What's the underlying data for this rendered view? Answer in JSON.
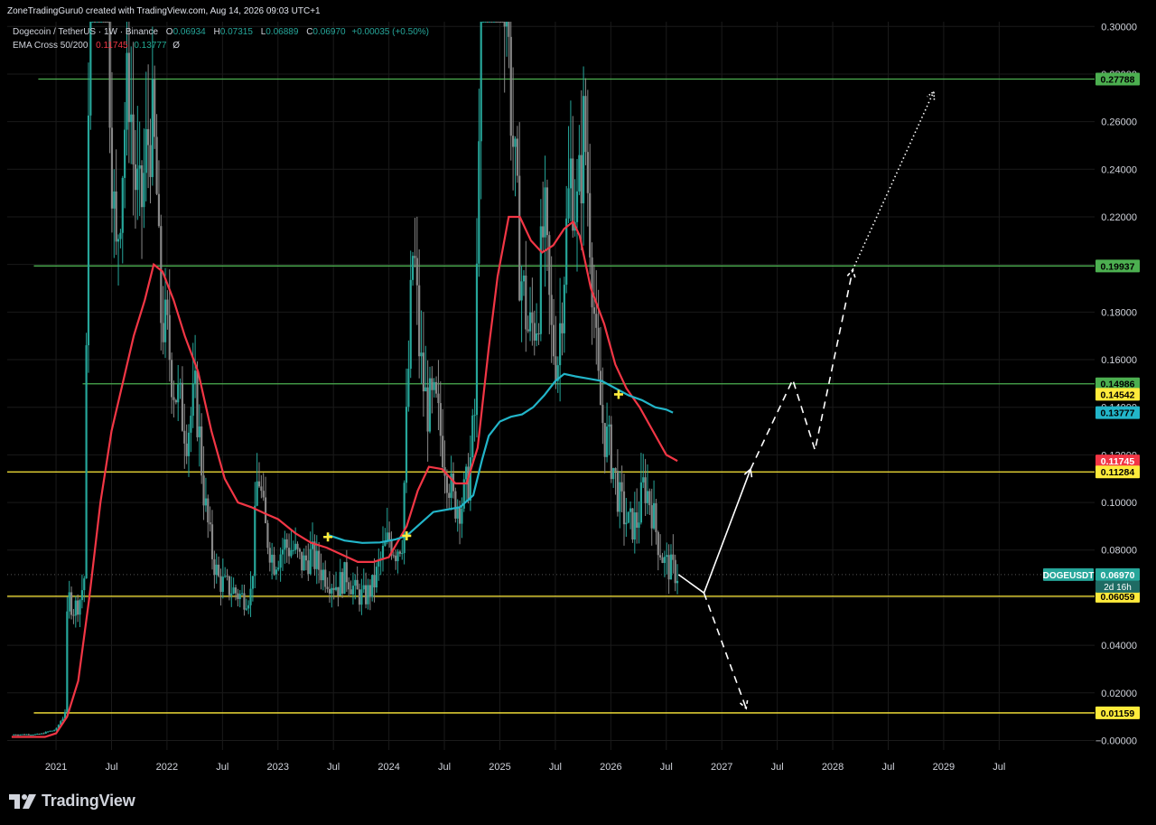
{
  "header": {
    "credit": "ZoneTradingGuru0 created with TradingView.com, Aug 14, 2026 09:03 UTC+1"
  },
  "legend": {
    "symbol_title": "Dogecoin / TetherUS · 1W · Binance",
    "open_label": "O",
    "open": "0.06934",
    "high_label": "H",
    "high": "0.07315",
    "low_label": "L",
    "low": "0.06889",
    "close_label": "C",
    "close": "0.06970",
    "change": "+0.00035 (+0.50%)",
    "ema_name": "EMA Cross 50/200",
    "ema_fast": "0.11745",
    "ema_slow": "0.13777",
    "ema_extra": "Ø"
  },
  "footer": {
    "brand": "TradingView"
  },
  "colors": {
    "background": "#000000",
    "grid": "#1a1a1a",
    "up": "#26a69a",
    "down": "#888888",
    "ema_fast": "#f23645",
    "ema_slow": "#22b5c9",
    "resistance_green": "#4caf50",
    "support_yellow": "#ffeb3b",
    "projection": "#ffffff",
    "cross_marker": "#ffeb3b",
    "axis_text": "#d1d4dc"
  },
  "chart_data": {
    "type": "candlestick",
    "symbol": "DOGEUSDT",
    "timeframe": "1W",
    "exchange": "Binance",
    "y_axis": {
      "ticks": [
        "0.30000",
        "0.28000",
        "0.26000",
        "0.24000",
        "0.22000",
        "0.20000",
        "0.18000",
        "0.16000",
        "0.14000",
        "0.12000",
        "0.10000",
        "0.08000",
        "0.06000",
        "0.04000",
        "0.02000",
        "−0.00000"
      ],
      "range": [
        -0.004,
        0.302
      ]
    },
    "x_axis": {
      "ticks": [
        {
          "label": "2021",
          "t": 2021.0
        },
        {
          "label": "Jul",
          "t": 2021.5
        },
        {
          "label": "2022",
          "t": 2022.0
        },
        {
          "label": "Jul",
          "t": 2022.5
        },
        {
          "label": "2023",
          "t": 2023.0
        },
        {
          "label": "Jul",
          "t": 2023.5
        },
        {
          "label": "2024",
          "t": 2024.0
        },
        {
          "label": "Jul",
          "t": 2024.5
        },
        {
          "label": "2025",
          "t": 2025.0
        },
        {
          "label": "Jul",
          "t": 2025.5
        },
        {
          "label": "2026",
          "t": 2026.0
        },
        {
          "label": "Jul",
          "t": 2026.5
        },
        {
          "label": "2027",
          "t": 2027.0
        },
        {
          "label": "Jul",
          "t": 2027.5
        },
        {
          "label": "2028",
          "t": 2028.0
        },
        {
          "label": "Jul",
          "t": 2028.5
        },
        {
          "label": "2029",
          "t": 2029.0
        },
        {
          "label": "Jul",
          "t": 2029.5
        }
      ],
      "range": [
        2020.56,
        2030.36
      ]
    },
    "price_path": [
      [
        2020.6,
        0.0025
      ],
      [
        2020.85,
        0.0026
      ],
      [
        2020.95,
        0.004
      ],
      [
        2021.0,
        0.0045
      ],
      [
        2021.04,
        0.008
      ],
      [
        2021.08,
        0.011
      ],
      [
        2021.1,
        0.05
      ],
      [
        2021.12,
        0.06
      ],
      [
        2021.16,
        0.055
      ],
      [
        2021.22,
        0.06
      ],
      [
        2021.26,
        0.07
      ],
      [
        2021.3,
        0.33
      ],
      [
        2021.34,
        0.4
      ],
      [
        2021.38,
        0.36
      ],
      [
        2021.42,
        0.45
      ],
      [
        2021.46,
        0.32
      ],
      [
        2021.5,
        0.25
      ],
      [
        2021.54,
        0.2
      ],
      [
        2021.58,
        0.23
      ],
      [
        2021.62,
        0.26
      ],
      [
        2021.66,
        0.28
      ],
      [
        2021.7,
        0.24
      ],
      [
        2021.76,
        0.22
      ],
      [
        2021.82,
        0.25
      ],
      [
        2021.86,
        0.26
      ],
      [
        2021.9,
        0.24
      ],
      [
        2021.94,
        0.18
      ],
      [
        2022.0,
        0.17
      ],
      [
        2022.06,
        0.15
      ],
      [
        2022.12,
        0.14
      ],
      [
        2022.18,
        0.13
      ],
      [
        2022.26,
        0.145
      ],
      [
        2022.34,
        0.1
      ],
      [
        2022.4,
        0.08
      ],
      [
        2022.46,
        0.068
      ],
      [
        2022.52,
        0.065
      ],
      [
        2022.6,
        0.063
      ],
      [
        2022.68,
        0.06
      ],
      [
        2022.76,
        0.062
      ],
      [
        2022.82,
        0.115
      ],
      [
        2022.88,
        0.09
      ],
      [
        2022.96,
        0.075
      ],
      [
        2023.06,
        0.082
      ],
      [
        2023.14,
        0.08
      ],
      [
        2023.22,
        0.074
      ],
      [
        2023.3,
        0.078
      ],
      [
        2023.38,
        0.072
      ],
      [
        2023.46,
        0.068
      ],
      [
        2023.54,
        0.065
      ],
      [
        2023.62,
        0.07
      ],
      [
        2023.7,
        0.062
      ],
      [
        2023.78,
        0.06
      ],
      [
        2023.86,
        0.065
      ],
      [
        2023.92,
        0.075
      ],
      [
        2024.0,
        0.085
      ],
      [
        2024.06,
        0.08
      ],
      [
        2024.12,
        0.085
      ],
      [
        2024.18,
        0.16
      ],
      [
        2024.22,
        0.21
      ],
      [
        2024.28,
        0.16
      ],
      [
        2024.34,
        0.14
      ],
      [
        2024.42,
        0.14
      ],
      [
        2024.5,
        0.12
      ],
      [
        2024.58,
        0.1
      ],
      [
        2024.66,
        0.1
      ],
      [
        2024.72,
        0.11
      ],
      [
        2024.78,
        0.14
      ],
      [
        2024.84,
        0.39
      ],
      [
        2024.9,
        0.42
      ],
      [
        2024.98,
        0.37
      ],
      [
        2025.06,
        0.31
      ],
      [
        2025.12,
        0.25
      ],
      [
        2025.18,
        0.2
      ],
      [
        2025.26,
        0.17
      ],
      [
        2025.34,
        0.18
      ],
      [
        2025.4,
        0.22
      ],
      [
        2025.46,
        0.17
      ],
      [
        2025.52,
        0.16
      ],
      [
        2025.58,
        0.2
      ],
      [
        2025.64,
        0.24
      ],
      [
        2025.7,
        0.22
      ],
      [
        2025.76,
        0.26
      ],
      [
        2025.82,
        0.21
      ],
      [
        2025.88,
        0.15
      ],
      [
        2025.94,
        0.13
      ],
      [
        2026.0,
        0.12
      ],
      [
        2026.08,
        0.1
      ],
      [
        2026.16,
        0.09
      ],
      [
        2026.24,
        0.092
      ],
      [
        2026.3,
        0.108
      ],
      [
        2026.36,
        0.1
      ],
      [
        2026.42,
        0.085
      ],
      [
        2026.48,
        0.075
      ],
      [
        2026.54,
        0.072
      ],
      [
        2026.61,
        0.0697
      ]
    ],
    "ema_fast": {
      "name": "EMA 50",
      "points": [
        [
          2020.6,
          0.0015
        ],
        [
          2020.9,
          0.0015
        ],
        [
          2021.0,
          0.003
        ],
        [
          2021.1,
          0.01
        ],
        [
          2021.2,
          0.025
        ],
        [
          2021.3,
          0.06
        ],
        [
          2021.4,
          0.1
        ],
        [
          2021.5,
          0.13
        ],
        [
          2021.6,
          0.15
        ],
        [
          2021.7,
          0.17
        ],
        [
          2021.8,
          0.185
        ],
        [
          2021.88,
          0.2
        ],
        [
          2021.96,
          0.197
        ],
        [
          2022.06,
          0.185
        ],
        [
          2022.16,
          0.17
        ],
        [
          2022.28,
          0.155
        ],
        [
          2022.4,
          0.13
        ],
        [
          2022.52,
          0.11
        ],
        [
          2022.64,
          0.1
        ],
        [
          2022.76,
          0.098
        ],
        [
          2022.9,
          0.095
        ],
        [
          2023.0,
          0.093
        ],
        [
          2023.16,
          0.087
        ],
        [
          2023.3,
          0.083
        ],
        [
          2023.44,
          0.081
        ],
        [
          2023.58,
          0.078
        ],
        [
          2023.72,
          0.075
        ],
        [
          2023.86,
          0.075
        ],
        [
          2024.0,
          0.077
        ],
        [
          2024.16,
          0.09
        ],
        [
          2024.26,
          0.105
        ],
        [
          2024.36,
          0.115
        ],
        [
          2024.48,
          0.114
        ],
        [
          2024.6,
          0.108
        ],
        [
          2024.7,
          0.108
        ],
        [
          2024.8,
          0.123
        ],
        [
          2024.9,
          0.165
        ],
        [
          2024.98,
          0.195
        ],
        [
          2025.08,
          0.22
        ],
        [
          2025.18,
          0.22
        ],
        [
          2025.28,
          0.21
        ],
        [
          2025.38,
          0.205
        ],
        [
          2025.48,
          0.208
        ],
        [
          2025.58,
          0.215
        ],
        [
          2025.66,
          0.218
        ],
        [
          2025.72,
          0.212
        ],
        [
          2025.82,
          0.19
        ],
        [
          2025.94,
          0.175
        ],
        [
          2026.04,
          0.158
        ],
        [
          2026.14,
          0.148
        ],
        [
          2026.26,
          0.14
        ],
        [
          2026.38,
          0.13
        ],
        [
          2026.5,
          0.12
        ],
        [
          2026.6,
          0.11745
        ]
      ]
    },
    "ema_slow": {
      "name": "EMA 200",
      "points": [
        [
          2023.44,
          0.0865
        ],
        [
          2023.6,
          0.084
        ],
        [
          2023.76,
          0.083
        ],
        [
          2023.92,
          0.0832
        ],
        [
          2024.06,
          0.0845
        ],
        [
          2024.16,
          0.086
        ],
        [
          2024.28,
          0.091
        ],
        [
          2024.4,
          0.096
        ],
        [
          2024.52,
          0.097
        ],
        [
          2024.64,
          0.098
        ],
        [
          2024.76,
          0.103
        ],
        [
          2024.84,
          0.118
        ],
        [
          2024.9,
          0.128
        ],
        [
          2025.0,
          0.134
        ],
        [
          2025.1,
          0.136
        ],
        [
          2025.2,
          0.137
        ],
        [
          2025.3,
          0.14
        ],
        [
          2025.4,
          0.145
        ],
        [
          2025.5,
          0.151
        ],
        [
          2025.58,
          0.154
        ],
        [
          2025.68,
          0.153
        ],
        [
          2025.8,
          0.152
        ],
        [
          2025.92,
          0.151
        ],
        [
          2026.04,
          0.148
        ],
        [
          2026.16,
          0.145
        ],
        [
          2026.28,
          0.143
        ],
        [
          2026.4,
          0.14
        ],
        [
          2026.5,
          0.139
        ],
        [
          2026.56,
          0.13777
        ]
      ]
    },
    "ema_crosses": [
      {
        "t": 2023.45,
        "y": 0.0855
      },
      {
        "t": 2024.16,
        "y": 0.086
      },
      {
        "t": 2026.07,
        "y": 0.1454
      }
    ],
    "horizontal_levels": [
      {
        "y": 0.27788,
        "color": "green",
        "from_t": 2020.84,
        "label": "0.27788"
      },
      {
        "y": 0.19937,
        "color": "green",
        "from_t": 2020.8,
        "label": "0.19937"
      },
      {
        "y": 0.14986,
        "color": "green",
        "from_t": 2021.24,
        "label": "0.14986"
      },
      {
        "y": 0.11284,
        "color": "yellow",
        "from_t": 2020.56,
        "label": "0.11284"
      },
      {
        "y": 0.06059,
        "color": "yellow",
        "from_t": 2020.56,
        "label": "0.06059"
      },
      {
        "y": 0.01159,
        "color": "yellow",
        "from_t": 2020.8,
        "label": "0.01159"
      }
    ],
    "price_tags": [
      {
        "label": "0.27788",
        "y": 0.27788,
        "bg": "#4caf50",
        "fg": "#000000"
      },
      {
        "label": "0.19937",
        "y": 0.19937,
        "bg": "#4caf50",
        "fg": "#000000"
      },
      {
        "label": "0.14986",
        "y": 0.14986,
        "bg": "#4caf50",
        "fg": "#000000"
      },
      {
        "label": "0.14542",
        "y": 0.14542,
        "bg": "#ffeb3b",
        "fg": "#000000"
      },
      {
        "label": "0.13777",
        "y": 0.13777,
        "bg": "#22b5c9",
        "fg": "#000000"
      },
      {
        "label": "0.11745",
        "y": 0.11745,
        "bg": "#f23645",
        "fg": "#ffffff"
      },
      {
        "label": "0.11284",
        "y": 0.11284,
        "bg": "#ffeb3b",
        "fg": "#000000"
      },
      {
        "label": "0.06970",
        "y": 0.0697,
        "bg": "#26a69a",
        "fg": "#ffffff"
      },
      {
        "label": "0.06059",
        "y": 0.06059,
        "bg": "#ffeb3b",
        "fg": "#000000"
      },
      {
        "label": "0.01159",
        "y": 0.01159,
        "bg": "#ffeb3b",
        "fg": "#000000"
      }
    ],
    "symbol_tag": "DOGEUSDT",
    "countdown": "2d 16h",
    "projections": [
      {
        "style": "solid",
        "points": [
          [
            2026.61,
            0.0697
          ],
          [
            2026.84,
            0.062
          ],
          [
            2027.26,
            0.114
          ]
        ]
      },
      {
        "style": "dashed",
        "points": [
          [
            2026.84,
            0.062
          ],
          [
            2027.22,
            0.0135
          ]
        ]
      },
      {
        "style": "dashed",
        "points": [
          [
            2027.26,
            0.114
          ],
          [
            2027.64,
            0.1516
          ],
          [
            2027.84,
            0.122
          ],
          [
            2028.18,
            0.1978
          ]
        ]
      },
      {
        "style": "dotted",
        "points": [
          [
            2028.18,
            0.1978
          ],
          [
            2028.91,
            0.2726
          ]
        ]
      }
    ]
  }
}
